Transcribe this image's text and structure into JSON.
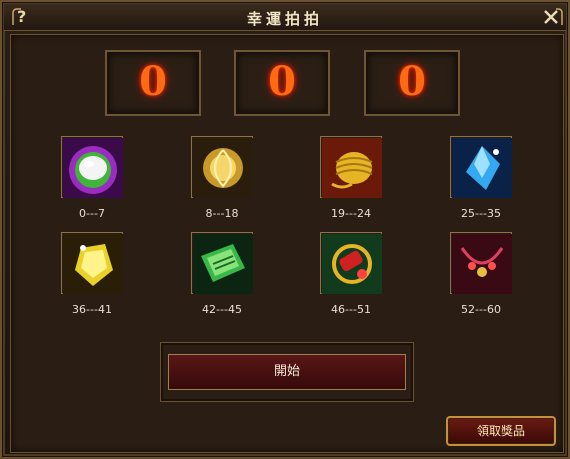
{
  "window": {
    "title": "幸運拍拍",
    "help_icon": "question-mark-icon",
    "close_icon": "close-x-icon"
  },
  "slots": [
    {
      "digit": "0"
    },
    {
      "digit": "0"
    },
    {
      "digit": "0"
    }
  ],
  "items": [
    {
      "range": "0---7",
      "icon": "white-gem-icon"
    },
    {
      "range": "8---18",
      "icon": "golden-orb-icon"
    },
    {
      "range": "19---24",
      "icon": "gold-coil-icon"
    },
    {
      "range": "25---35",
      "icon": "blue-crystal-icon"
    },
    {
      "range": "36---41",
      "icon": "yellow-gem-icon"
    },
    {
      "range": "42---45",
      "icon": "green-scroll-icon"
    },
    {
      "range": "46---51",
      "icon": "red-bracelet-icon"
    },
    {
      "range": "52---60",
      "icon": "red-necklace-icon"
    }
  ],
  "buttons": {
    "start": "開始",
    "claim": "領取獎品"
  },
  "colors": {
    "digit": "#ff6a12",
    "frame": "#6a5230",
    "button_red": "#5a1616"
  }
}
